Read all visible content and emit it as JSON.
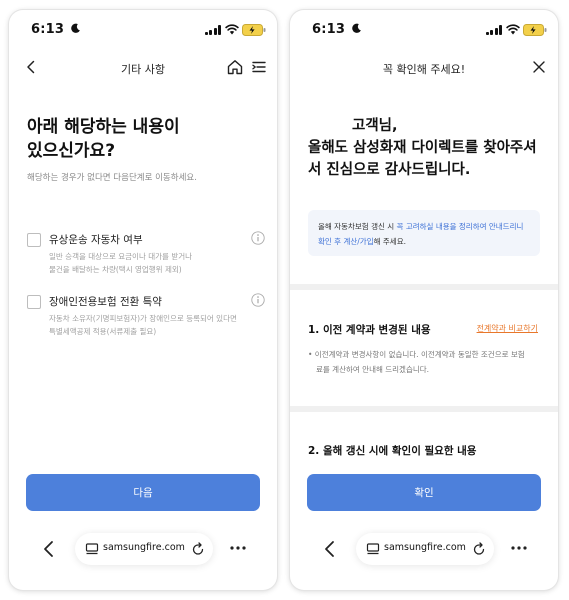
{
  "status": {
    "time": "6:13"
  },
  "left": {
    "header": {
      "title": "기타 사항"
    },
    "heading": {
      "line1": "아래 해당하는 내용이",
      "line2": "있으신가요?"
    },
    "subtext": "해당하는 경우가 없다면 다음단계로 이동하세요.",
    "options": [
      {
        "title": "유상운송 자동차 여부",
        "desc1": "일반 승객을 대상으로 요금이나 대가를 받거나",
        "desc2": "물건을 배달하는 차량(택시 영업행위 제외)"
      },
      {
        "title": "장애인전용보험 전환 특약",
        "desc1": "자동차 소유자(기명피보험자)가 장애인으로 등록되어 있다면",
        "desc2": "특별세액공제 적용(서류제출 필요)"
      }
    ],
    "next_button": "다음"
  },
  "right": {
    "header": {
      "title": "꼭 확인해 주세요!"
    },
    "greeting": {
      "line1": "고객님,",
      "line2": "올해도 삼성화재 다이렉트를 찾아주셔",
      "line3": "서 진심으로 감사드립니다."
    },
    "notice": {
      "part1": "올해 자동차보험 갱신 시 ",
      "highlight1": "꼭 고려하실 내용을 정리하여 안내드리니",
      "highlight2": "확인 후 계산/가입",
      "part2": "해 주세요."
    },
    "section1": {
      "title": "1. 이전 계약과 변경된 내용",
      "link": "전계약과 비교하기",
      "desc1": "• 이전계약과 변경사항이 없습니다. 이전계약과 동일한 조건으로 보험",
      "desc2": "료를 계산하여 안내해 드리겠습니다."
    },
    "section2": {
      "title": "2. 올해 갱신 시에 확인이 필요한 내용"
    },
    "confirm_button": "확인"
  },
  "browser": {
    "url": "samsungfire.com"
  },
  "colors": {
    "primary": "#4d80db",
    "link_orange": "#e8772b",
    "highlight_blue": "#3b6fd6"
  }
}
